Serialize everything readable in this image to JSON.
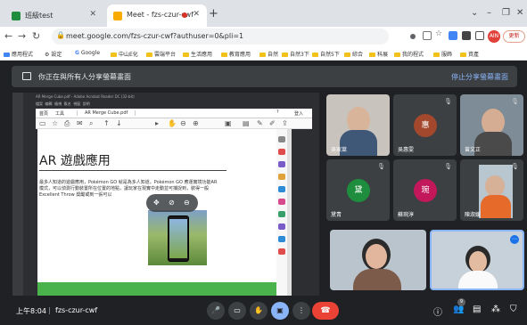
{
  "tabs": [
    {
      "label": "班級test"
    },
    {
      "label": "Meet - fzs-czur-cwf"
    }
  ],
  "address": {
    "url": "meet.google.com/fzs-czur-cwf?authuser=0&pli=1"
  },
  "update_button": "更新",
  "bookmarks": [
    "應用程式",
    "設定",
    "Google",
    "中山E化",
    "雲端平台",
    "生活應用",
    "教育應用",
    "自然",
    "自然3下",
    "自然5下",
    "綜合",
    "科展",
    "我的程式",
    "服飾",
    "資產"
  ],
  "banner": {
    "text": "你正在與所有人分享螢幕畫面",
    "stop_label": "停止分享螢幕畫面"
  },
  "pdf": {
    "window_title": "AR Merge Cube.pdf - Adobe Acrobat Reader DC (32-bit)",
    "menus": [
      "檔案",
      "編輯",
      "檢視",
      "簽名",
      "視窗",
      "說明"
    ],
    "tabs": [
      "首頁",
      "工具",
      "AR Merge Cube.pdf"
    ],
    "signin": "登入",
    "heading": "AR 遊戲應用",
    "body1": "最多人知道的遊戲應用，Pokémon GO 就是為多人知道。Pokémon GO 應運實境功能AR",
    "body2": "模式，可以偵測行動裝置所在位置的地點，讓玩家在現實中走動並可捕捉到，裝得一般",
    "body3": "Excellent Throw 獎勵或到一張可以"
  },
  "participants": [
    {
      "name": "吳家棻"
    },
    {
      "name": "吳惠雯",
      "initial": "惠"
    },
    {
      "name": "曾文正"
    },
    {
      "name": "黛青",
      "initial": "黛"
    },
    {
      "name": "蘇琬淳",
      "initial": "琬"
    },
    {
      "name": "陳淑媛"
    }
  ],
  "bottom": {
    "time": "上午8:04",
    "separator": "|",
    "meeting_code": "fzs-czur-cwf",
    "people_count": "9"
  },
  "colors": {
    "meet_bg": "#202124",
    "tile_bg": "#3c4043",
    "end_call": "#ea4335",
    "link": "#8ab4f8"
  }
}
